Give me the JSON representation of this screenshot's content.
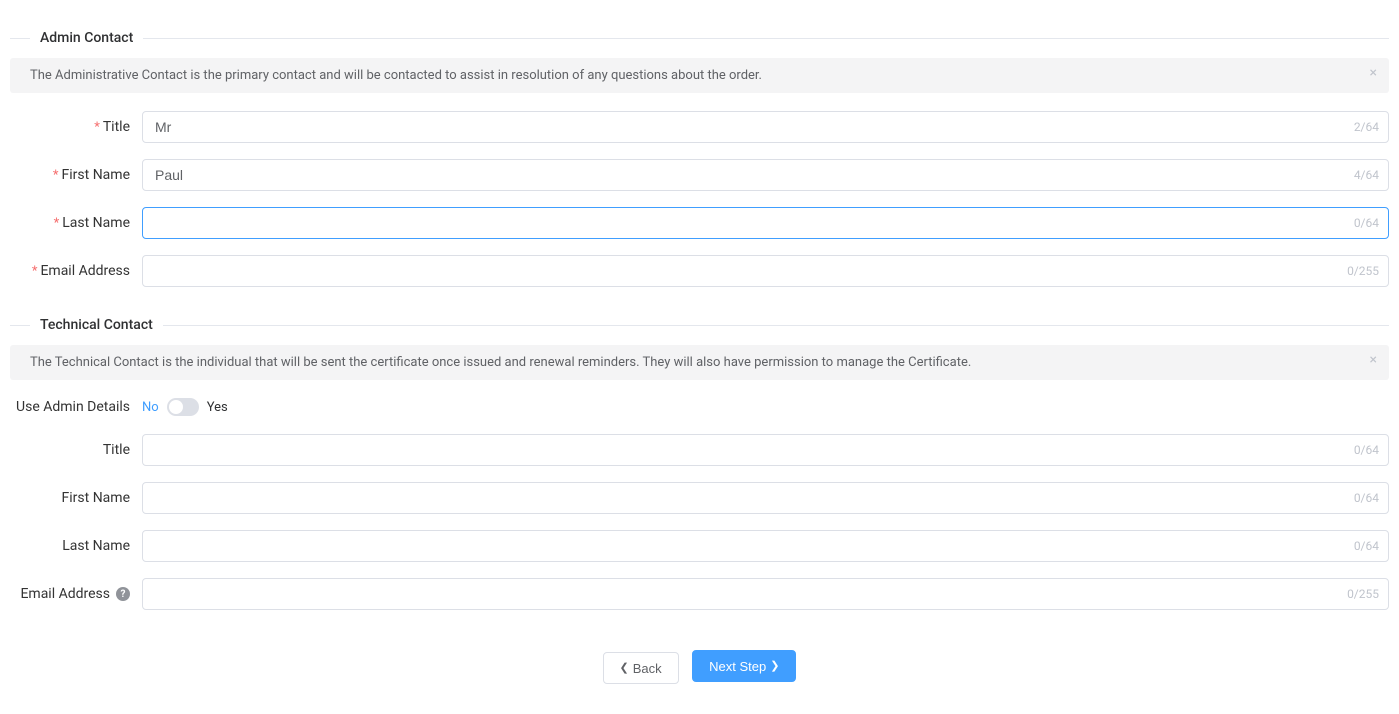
{
  "sections": {
    "admin": {
      "heading": "Admin Contact",
      "info_text": "The Administrative Contact is the primary contact and will be contacted to assist in resolution of any questions about the order.",
      "fields": {
        "title": {
          "label": "Title",
          "value": "Mr",
          "counter": "2/64",
          "required": true
        },
        "first_name": {
          "label": "First Name",
          "value": "Paul",
          "counter": "4/64",
          "required": true
        },
        "last_name": {
          "label": "Last Name",
          "value": "",
          "counter": "0/64",
          "required": true
        },
        "email": {
          "label": "Email Address",
          "value": "",
          "counter": "0/255",
          "required": true
        }
      }
    },
    "technical": {
      "heading": "Technical Contact",
      "info_text": "The Technical Contact is the individual that will be sent the certificate once issued and renewal reminders. They will also have permission to manage the Certificate.",
      "use_admin": {
        "label": "Use Admin Details",
        "no_label": "No",
        "yes_label": "Yes",
        "value": false
      },
      "fields": {
        "title": {
          "label": "Title",
          "value": "",
          "counter": "0/64"
        },
        "first_name": {
          "label": "First Name",
          "value": "",
          "counter": "0/64"
        },
        "last_name": {
          "label": "Last Name",
          "value": "",
          "counter": "0/64"
        },
        "email": {
          "label": "Email Address",
          "value": "",
          "counter": "0/255",
          "help": true
        }
      }
    }
  },
  "buttons": {
    "back": "Back",
    "next": "Next Step"
  }
}
